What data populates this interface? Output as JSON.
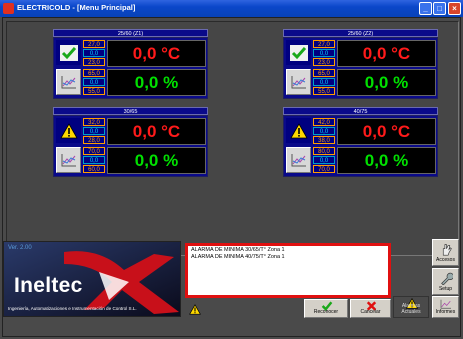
{
  "window": {
    "title": "ELECTRICOLD - [Menu Principal]"
  },
  "zones": [
    {
      "name": "25/60 (Z1)",
      "status": "ok",
      "temp_high": "27,0",
      "temp_set": "0,0",
      "temp_low": "23,0",
      "hum_high": "65,0",
      "hum_set": "0,0",
      "hum_low": "55,0",
      "temp": "0,0 °C",
      "hum": "0,0 %"
    },
    {
      "name": "25/60 (Z2)",
      "status": "ok",
      "temp_high": "27,0",
      "temp_set": "0,0",
      "temp_low": "23,0",
      "hum_high": "65,0",
      "hum_set": "0,0",
      "hum_low": "55,0",
      "temp": "0,0 °C",
      "hum": "0,0 %"
    },
    {
      "name": "30/65",
      "status": "warning",
      "temp_high": "32,0",
      "temp_set": "0,0",
      "temp_low": "28,0",
      "hum_high": "70,0",
      "hum_set": "0,0",
      "hum_low": "60,0",
      "temp": "0,0 °C",
      "hum": "0,0 %"
    },
    {
      "name": "40/75",
      "status": "warning",
      "temp_high": "42,0",
      "temp_set": "0,0",
      "temp_low": "38,0",
      "hum_high": "80,0",
      "hum_set": "0,0",
      "hum_low": "70,0",
      "temp": "0,0 °C",
      "hum": "0,0 %"
    }
  ],
  "logo": {
    "version": "Ver. 2.00",
    "word": "Ineltec",
    "tagline": "Ingeniería, Automatizaciones e Instrumentación de Control S.L."
  },
  "alarms": [
    "ALARMA DE MINIMA 30/65/T° Zona 1",
    "ALARMA DE MINIMA 40/75/T° Zona 1"
  ],
  "buttons": {
    "reconocer": "Reconocer",
    "cancelar": "Cancelar",
    "alarmas": "Alarmas Actuales",
    "informes": "Informes",
    "accesos": "Accesos",
    "setup": "Setup"
  },
  "colors": {
    "panel_blue": "#0a0a8a",
    "temp_red": "#ff1a1a",
    "hum_green": "#00e000",
    "limit_orange": "#ff9d00",
    "setpoint_cyan": "#00d8ff",
    "alarm_border": "#e01010"
  }
}
